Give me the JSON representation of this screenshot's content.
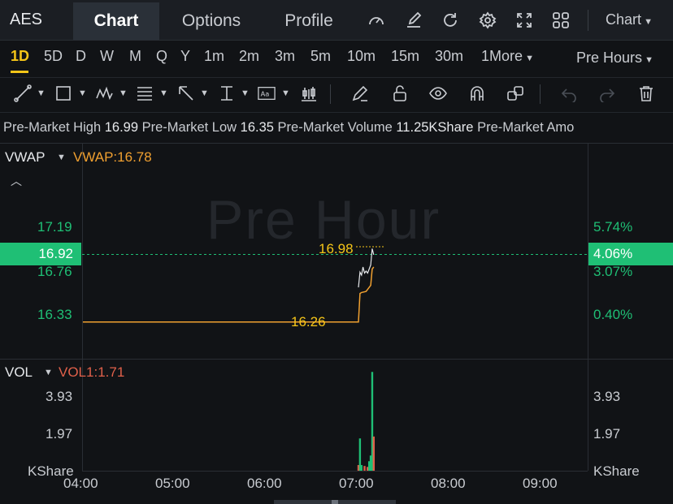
{
  "header": {
    "ticker": "AES",
    "tabs": [
      {
        "label": "Chart",
        "active": true
      },
      {
        "label": "Options",
        "active": false
      },
      {
        "label": "Profile",
        "active": false
      }
    ],
    "icons": [
      "gauge-icon",
      "edit-icon",
      "refresh-icon",
      "settings-icon",
      "fullscreen-icon",
      "grid-icon"
    ],
    "chart_dropdown": "Chart"
  },
  "periods": [
    "1D",
    "5D",
    "D",
    "W",
    "M",
    "Q",
    "Y",
    "1m",
    "2m",
    "3m",
    "5m",
    "10m",
    "15m",
    "30m",
    "1More"
  ],
  "active_period": "1D",
  "session_dropdown": "Pre Hours",
  "info": {
    "high_label": "Pre-Market High",
    "high": "16.99",
    "low_label": "Pre-Market Low",
    "low": "16.35",
    "volume_label": "Pre-Market Volume",
    "volume": "11.25KShare",
    "amount_label": "Pre-Market Amo"
  },
  "price_panel": {
    "indicator": "VWAP",
    "indicator_value": "VWAP:16.78",
    "watermark": "Pre Hour",
    "left_ticks": [
      "17.19",
      "16.76",
      "16.33"
    ],
    "right_ticks": [
      "5.74%",
      "3.07%",
      "0.40%"
    ],
    "current_price": "16.92",
    "current_pct": "4.06%",
    "high_marker": "16.98",
    "low_marker": "16.26",
    "colors": {
      "up": "#1fbf75",
      "vwap": "#f0a030",
      "marker": "#f5c518"
    }
  },
  "volume_panel": {
    "indicator": "VOL",
    "indicator_value": "VOL1:1.71",
    "left_ticks": [
      "3.93",
      "1.97",
      "KShare"
    ],
    "right_ticks": [
      "3.93",
      "1.97",
      "KShare"
    ]
  },
  "time_axis": [
    "04:00",
    "05:00",
    "06:00",
    "07:00",
    "08:00",
    "09:00"
  ],
  "chart_data": {
    "type": "line",
    "x_range": [
      "04:00",
      "09:30"
    ],
    "y_range": [
      16.2,
      17.3
    ],
    "price_series": [
      {
        "t": "07:00",
        "v": 16.6
      },
      {
        "t": "07:01",
        "v": 16.75
      },
      {
        "t": "07:02",
        "v": 16.72
      },
      {
        "t": "07:03",
        "v": 16.8
      },
      {
        "t": "07:04",
        "v": 16.74
      },
      {
        "t": "07:05",
        "v": 16.76
      },
      {
        "t": "07:06",
        "v": 16.74
      },
      {
        "t": "07:07",
        "v": 16.78
      },
      {
        "t": "07:08",
        "v": 16.82
      },
      {
        "t": "07:09",
        "v": 16.98
      },
      {
        "t": "07:10",
        "v": 16.92
      }
    ],
    "vwap_series": [
      {
        "t": "04:00",
        "v": 16.26
      },
      {
        "t": "07:00",
        "v": 16.26
      },
      {
        "t": "07:01",
        "v": 16.54
      },
      {
        "t": "07:02",
        "v": 16.55
      },
      {
        "t": "07:05",
        "v": 16.56
      },
      {
        "t": "07:08",
        "v": 16.62
      },
      {
        "t": "07:09",
        "v": 16.78
      },
      {
        "t": "07:10",
        "v": 16.8
      }
    ],
    "volume_bars": [
      {
        "t": "07:00",
        "v": 0.3,
        "color": "#e0604a"
      },
      {
        "t": "07:01",
        "v": 1.7,
        "color": "#1fbf75"
      },
      {
        "t": "07:02",
        "v": 0.3,
        "color": "#1fbf75"
      },
      {
        "t": "07:04",
        "v": 0.25,
        "color": "#e0604a"
      },
      {
        "t": "07:06",
        "v": 0.2,
        "color": "#e0604a"
      },
      {
        "t": "07:07",
        "v": 0.5,
        "color": "#1fbf75"
      },
      {
        "t": "07:08",
        "v": 0.8,
        "color": "#1fbf75"
      },
      {
        "t": "07:09",
        "v": 5.2,
        "color": "#1fbf75"
      },
      {
        "t": "07:10",
        "v": 1.8,
        "color": "#e0604a"
      }
    ],
    "volume_range": [
      0,
      5.5
    ]
  }
}
